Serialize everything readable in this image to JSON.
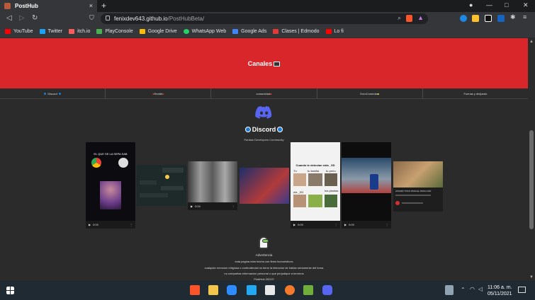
{
  "browser": {
    "tab_title": "PostHub",
    "tab_close": "×",
    "new_tab": "+",
    "url_host": "fenixdev643.github.io",
    "url_path": "/PostHubBeta/",
    "minimize": "—",
    "maximize": "□",
    "close": "✕"
  },
  "bookmarks": [
    {
      "label": "YouTube",
      "color": "#ff0000"
    },
    {
      "label": "Twitter",
      "color": "#1da1f2"
    },
    {
      "label": "itch.io",
      "color": "#fa5c5c"
    },
    {
      "label": "PlayConsole",
      "color": "#4caf50"
    },
    {
      "label": "Google Drive",
      "color": "#fbbc04"
    },
    {
      "label": "WhatsApp Web",
      "color": "#25d366"
    },
    {
      "label": "Google Ads",
      "color": "#4285f4"
    },
    {
      "label": "Clases | Edmodo",
      "color": "#e53935"
    },
    {
      "label": "Lo fi",
      "color": "#ff0000"
    }
  ],
  "page": {
    "banner_title": "Canales",
    "channels": [
      "Discord",
      "Reddit",
      "comunidad",
      "DomComedia",
      "Fuenas y dirtjuedo"
    ],
    "discord_title": "Discord",
    "discord_subtitle": "Panitas Developers Community",
    "video_time": "0:00",
    "card_text": {
      "card1_caption": "EL QUE SE LA SEPA SAB",
      "card5_header": "Cuando te detectan sida _XD",
      "card5_labels": [
        "Tú",
        "tu familia",
        "tu perro",
        "ola _XD",
        "tus plantas"
      ],
      "card7_title": "ASUMIR TODO PARA EL PARA GOD"
    },
    "warning_title": "Advertencia",
    "warning_lines": [
      "esta pagina esta hecha con fines humoristicos",
      "cualquier mencion religiosa o controdercial no tiene la intencion de hablar seriamente del tema",
      "no compartas informacion personal o que perjudique a terceros",
      "PostHub 2021©"
    ]
  },
  "taskbar": {
    "time": "11:06 a. m.",
    "date": "05/11/2021"
  },
  "colors": {
    "banner": "#d8262a",
    "page_bg": "#2b2b2b",
    "discord_blurple": "#5865f2"
  }
}
